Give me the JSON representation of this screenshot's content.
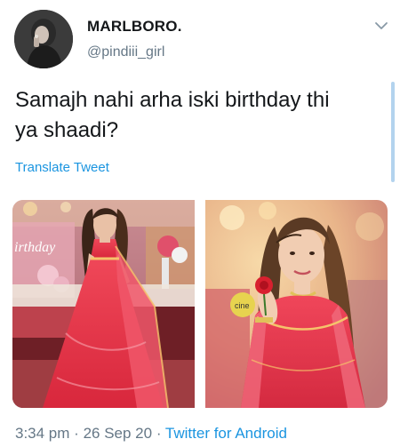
{
  "tweet": {
    "display_name": "MARLBORO.",
    "handle": "@pindiii_girl",
    "text": "Samajh nahi arha iski birthday thi\nya shaadi?",
    "translate_label": "Translate Tweet",
    "time": "3:34 pm",
    "separator": "·",
    "date": "26 Sep 20",
    "source": "Twitter for Android"
  },
  "media": {
    "left_backdrop_text": "irthday",
    "right_badge_text": "cine"
  },
  "colors": {
    "link_blue": "#1b95e0",
    "secondary_gray": "#657786",
    "dress_red": "#e8304a"
  },
  "icons": {
    "menu": "chevron-down-icon"
  }
}
